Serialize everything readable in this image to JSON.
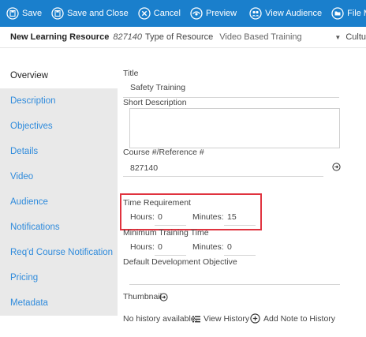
{
  "toolbar": {
    "save": "Save",
    "save_close": "Save and Close",
    "cancel": "Cancel",
    "preview": "Preview",
    "view_audience": "View Audience",
    "file_manager": "File Manager"
  },
  "header": {
    "title": "New Learning Resource",
    "id": "827140",
    "type_label": "Type of Resource",
    "type_value": "Video Based Training",
    "culture_label": "Cultu"
  },
  "sidebar": {
    "items": [
      {
        "label": "Overview",
        "active": true
      },
      {
        "label": "Description"
      },
      {
        "label": "Objectives"
      },
      {
        "label": "Details"
      },
      {
        "label": "Video"
      },
      {
        "label": "Audience"
      },
      {
        "label": "Notifications"
      },
      {
        "label": "Req'd Course Notification"
      },
      {
        "label": "Pricing"
      },
      {
        "label": "Metadata"
      }
    ]
  },
  "form": {
    "title_label": "Title",
    "title_value": "Safety Training",
    "short_desc_label": "Short Description",
    "short_desc_value": "",
    "course_ref_label": "Course #/Reference #",
    "course_ref_value": "827140",
    "time_req_label": "Time Requirement",
    "hours_label": "Hours:",
    "time_hours_value": "0",
    "minutes_label": "Minutes:",
    "time_minutes_value": "15",
    "min_training_label": "Minimum Training Time",
    "min_hours_value": "0",
    "min_minutes_value": "0",
    "dev_objective_label": "Default Development Objective",
    "dev_objective_value": "",
    "thumbnail_label": "Thumbnail"
  },
  "history": {
    "none_text": "No history available.",
    "view_history": "View History",
    "add_note": "Add Note to History"
  },
  "colors": {
    "toolbar_bg": "#1a7fcc",
    "sidebar_link": "#2f8bdc",
    "highlight": "#e0333f"
  }
}
